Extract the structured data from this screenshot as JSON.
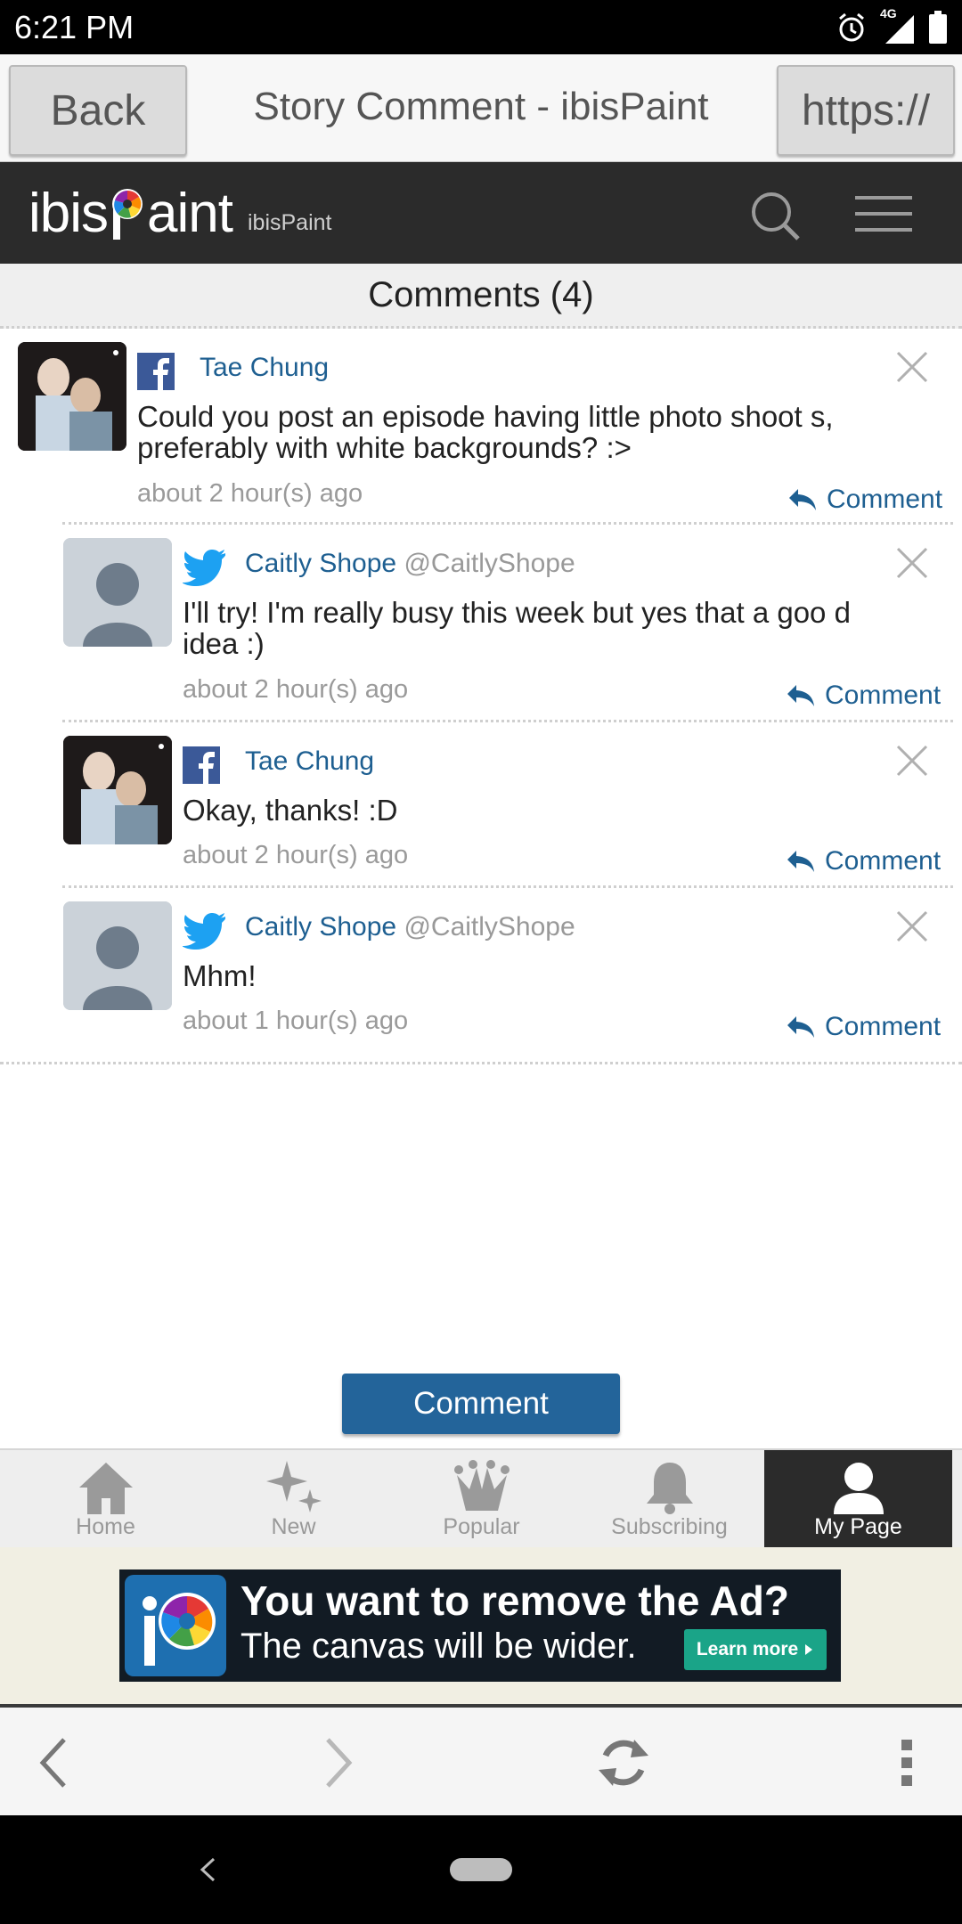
{
  "status": {
    "time": "6:21 PM",
    "network": "4G"
  },
  "topbar": {
    "back": "Back",
    "title": "Story Comment - ibisPaint",
    "url": "https://"
  },
  "site": {
    "logo": "ibisPaint",
    "name": "ibisPaint"
  },
  "comments_header": "Comments (4)",
  "comments": [
    {
      "author": "Tae Chung",
      "handle": "",
      "network": "facebook",
      "text": "Could you post an episode having little photo shoot s, preferably with white backgrounds? :>",
      "time": "about 2 hour(s) ago",
      "reply": "Comment"
    },
    {
      "author": "Caitly Shope",
      "handle": "@CaitlyShope",
      "network": "twitter",
      "text": "I'll try! I'm really busy this week but yes that a goo d idea :)",
      "time": "about 2 hour(s) ago",
      "reply": "Comment"
    },
    {
      "author": "Tae Chung",
      "handle": "",
      "network": "facebook",
      "text": "Okay, thanks! :D",
      "time": "about 2 hour(s) ago",
      "reply": "Comment"
    },
    {
      "author": "Caitly Shope",
      "handle": "@CaitlyShope",
      "network": "twitter",
      "text": "Mhm!",
      "time": "about 1 hour(s) ago",
      "reply": "Comment"
    }
  ],
  "comment_button": "Comment",
  "nav": [
    {
      "label": "Home",
      "icon": "home-icon"
    },
    {
      "label": "New",
      "icon": "sparkle-icon"
    },
    {
      "label": "Popular",
      "icon": "crown-icon"
    },
    {
      "label": "Subscribing",
      "icon": "bell-icon"
    },
    {
      "label": "My Page",
      "icon": "user-icon",
      "active": true
    }
  ],
  "ad": {
    "title": "You want to remove the Ad?",
    "subtitle": "The canvas will be wider.",
    "cta": "Learn more"
  },
  "colors": {
    "accent": "#23649a",
    "link": "#1e5f91",
    "header": "#2b2b2b"
  }
}
